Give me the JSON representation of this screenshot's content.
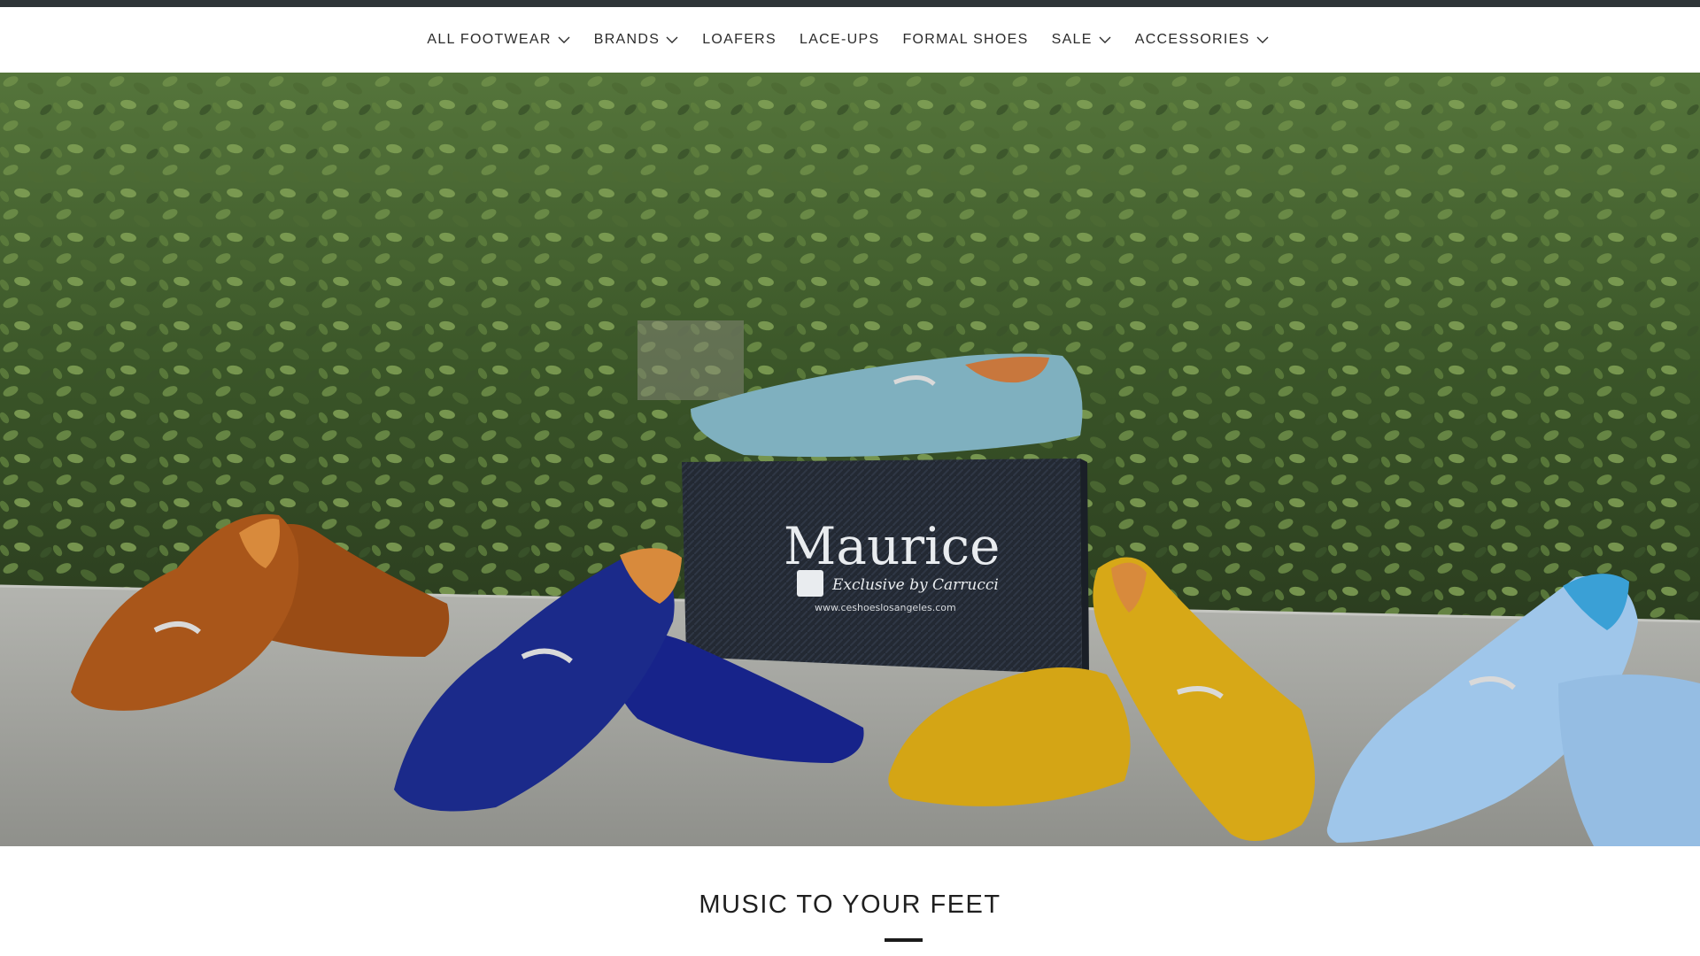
{
  "nav": {
    "items": [
      {
        "label": "ALL FOOTWEAR",
        "has_dropdown": true
      },
      {
        "label": "BRANDS",
        "has_dropdown": true
      },
      {
        "label": "LOAFERS",
        "has_dropdown": false
      },
      {
        "label": "LACE-UPS",
        "has_dropdown": false
      },
      {
        "label": "FORMAL SHOES",
        "has_dropdown": false
      },
      {
        "label": "SALE",
        "has_dropdown": true
      },
      {
        "label": "ACCESSORIES",
        "has_dropdown": true
      }
    ]
  },
  "hero": {
    "box_brand": "Maurice",
    "box_tagline": "Exclusive by Carrucci",
    "box_url": "www.ceshoeslosangeles.com",
    "shoe_colors": [
      "#a9561a",
      "#1b2a8a",
      "#7fb0bf",
      "#d7a817",
      "#9fc6ea"
    ]
  },
  "section": {
    "title": "MUSIC TO YOUR FEET"
  },
  "colors": {
    "top_strip": "#2e3538",
    "foliage": "#3d5a2c",
    "ledge": "#a9aaa5"
  }
}
